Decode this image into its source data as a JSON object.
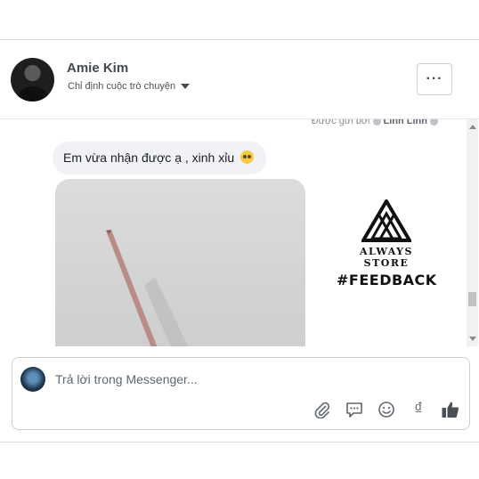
{
  "header": {
    "name": "Amie Kim",
    "assign_label": "Chỉ định cuộc trò chuyện",
    "more_label": "···"
  },
  "conversation": {
    "sent_by_prefix": "Được gửi bởi",
    "sent_by_name": "Linh Linh",
    "message_text": "Em vừa nhận được ạ , xinh xỉu",
    "brand_name": "ALWAYS STORE",
    "brand_tag": "#FEEDBACK"
  },
  "composer": {
    "placeholder": "Trả lời trong Messenger...",
    "tools": [
      "attach-icon",
      "quick-reply-icon",
      "emoji-icon",
      "currency-dong-icon",
      "like-icon"
    ],
    "currency_symbol": "₫"
  },
  "colors": {
    "border": "#ccd0d5",
    "bubble": "#f0f2f5",
    "icon": "#606770"
  }
}
